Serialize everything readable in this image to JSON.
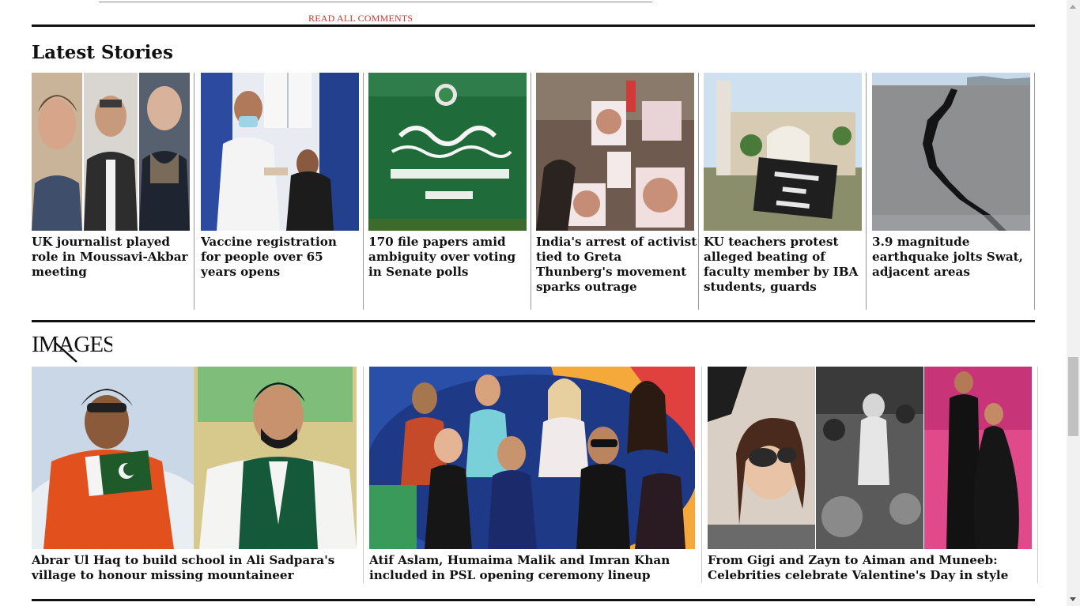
{
  "comments": {
    "read_all_label": "READ ALL COMMENTS"
  },
  "latest": {
    "title": "Latest Stories",
    "stories": [
      {
        "headline": "UK journalist played role in Moussavi-Akbar meeting",
        "image": "three-men-collage"
      },
      {
        "headline": "Vaccine registration for people over 65 years opens",
        "image": "vaccination-photo"
      },
      {
        "headline": "170 file papers amid ambiguity over voting in Senate polls",
        "image": "election-commission-sign"
      },
      {
        "headline": "India's arrest of activist tied to Greta Thunberg's movement sparks outrage",
        "image": "protest-posters"
      },
      {
        "headline": "KU teachers protest alleged beating of faculty member by IBA students, guards",
        "image": "university-gate"
      },
      {
        "headline": "3.9 magnitude earthquake jolts Swat, adjacent areas",
        "image": "cracked-road"
      }
    ]
  },
  "images_section": {
    "logo_text": "IMAGES",
    "galleries": [
      {
        "headline": "Abrar Ul Haq to build school in Ali Sadpara's village to honour missing mountaineer",
        "image": "mountaineer-singer-collage"
      },
      {
        "headline": "Atif Aslam, Humaima Malik and Imran Khan included in PSL opening ceremony lineup",
        "image": "psl-performers-group"
      },
      {
        "headline": "From Gigi and Zayn to Aiman and Muneeb: Celebrities celebrate Valentine's Day in style",
        "image": "celebrity-couples-collage"
      }
    ]
  },
  "colors": {
    "accent_link": "#c0392b",
    "rule": "#111111"
  }
}
